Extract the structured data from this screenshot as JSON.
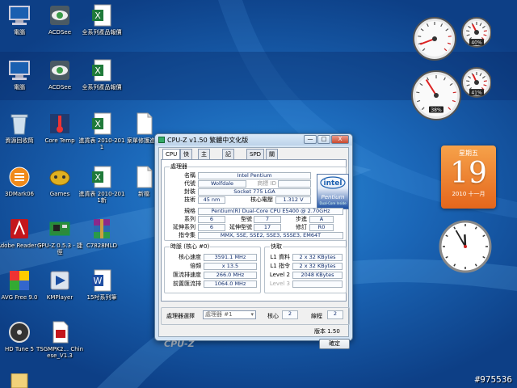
{
  "desktop": {
    "icons": [
      {
        "key": "computer",
        "label": "電腦"
      },
      {
        "key": "acdsee",
        "label": "ACDSee"
      },
      {
        "key": "excel-top",
        "label": "全系列產品報價"
      },
      {
        "key": "computer2",
        "label": "電腦"
      },
      {
        "key": "acdsee2",
        "label": "ACDSee"
      },
      {
        "key": "excel-top2",
        "label": "全系列產品報價"
      },
      {
        "key": "recycle",
        "label": "資源回收筒"
      },
      {
        "key": "coretemp",
        "label": "Core Temp"
      },
      {
        "key": "excel-2010",
        "label": "進貨表 2010-2011"
      },
      {
        "key": "doc-repair",
        "label": "案單修護進報"
      },
      {
        "key": "3dmark",
        "label": "3DMark06"
      },
      {
        "key": "games",
        "label": "Games"
      },
      {
        "key": "excel-2010b",
        "label": "進貨表 2010-2011新"
      },
      {
        "key": "doc-new",
        "label": "新檔"
      },
      {
        "key": "adobe",
        "label": "Adobe Reader 9"
      },
      {
        "key": "gpuz",
        "label": "GPU-Z 0.5.3 - 捷徑"
      },
      {
        "key": "winrar",
        "label": "C7828MLD"
      },
      {
        "key": "avg",
        "label": "AVG Free 9.0"
      },
      {
        "key": "kmplayer",
        "label": "KMPlayer"
      },
      {
        "key": "word",
        "label": "15吋系列筆"
      },
      {
        "key": "hdtune",
        "label": "HD Tune 5"
      },
      {
        "key": "txgame",
        "label": "TSGMPK2... Chinese_V1.3"
      }
    ],
    "gadgets": {
      "meter1": {
        "cpu": 9,
        "mem": 40,
        "mem_label": "40%"
      },
      "meter2": {
        "cpu": 38,
        "cpu_label": "38%",
        "mem": 41,
        "mem_label": "41%"
      },
      "calendar": {
        "weekday": "星期五",
        "day": "19",
        "year_month": "2010 十一月"
      },
      "clock": {
        "hour": 11,
        "minute": 55
      }
    },
    "watermark": "#975536"
  },
  "window": {
    "title": "CPU-Z v1.50 繁體中文化版",
    "controls": {
      "minimize": "—",
      "maximize": "□",
      "close": "X"
    },
    "tabs": [
      "CPU",
      "快取",
      "主機板",
      "記憶體",
      "SPD",
      "關於"
    ],
    "processor": {
      "group_title": "處理器",
      "labels": {
        "name": "名稱",
        "codename": "代號",
        "package": "封裝",
        "technology": "技術",
        "core_voltage": "核心電壓",
        "spec": "規格",
        "family": "系列",
        "model": "型號",
        "stepping": "步進",
        "ext_family": "延伸系列",
        "ext_model": "延伸型號",
        "revision": "修訂",
        "instructions": "指令集",
        "brand_id": "商標 ID"
      },
      "values": {
        "name": "Intel Pentium",
        "codename": "Wolfdale",
        "brand_id": "",
        "package": "Socket 775 LGA",
        "technology": "45 nm",
        "core_voltage": "1.312 V",
        "spec": "Pentium(R) Dual-Core  CPU    E5400  @ 2.70GHz",
        "family": "6",
        "model": "7",
        "stepping": "A",
        "ext_family": "6",
        "ext_model": "17",
        "revision": "R0",
        "instructions": "MMX, SSE, SSE2, SSE3, SSSE3, EM64T"
      },
      "logo": {
        "brand": "intel",
        "product": "Pentium",
        "sub": "Dual-Core Inside"
      }
    },
    "clocks": {
      "group_title": "時脈 (核心 #0)",
      "labels": {
        "core_speed": "核心速度",
        "multiplier": "倍頻",
        "bus_speed": "匯流排速度",
        "rated_fsb": "前置匯流排"
      },
      "values": {
        "core_speed": "3591.1 MHz",
        "multiplier": "x 13.5",
        "bus_speed": "266.0 MHz",
        "rated_fsb": "1064.0 MHz"
      }
    },
    "cache": {
      "group_title": "快取",
      "labels": {
        "l1_data": "L1 資料",
        "l1_inst": "L1 指令",
        "level2": "Level 2",
        "level3": "Level 3"
      },
      "values": {
        "l1_data": "2 x 32 KBytes",
        "l1_inst": "2 x 32 KBytes",
        "level2": "2048 KBytes",
        "level3": ""
      }
    },
    "selection": {
      "label": "處理器選擇",
      "value": "處理器 #1",
      "cores_label": "核心",
      "cores": "2",
      "threads_label": "線程",
      "threads": "2"
    },
    "version": "版本 1.50",
    "brand": "CPU-Z",
    "ok": "確定"
  }
}
